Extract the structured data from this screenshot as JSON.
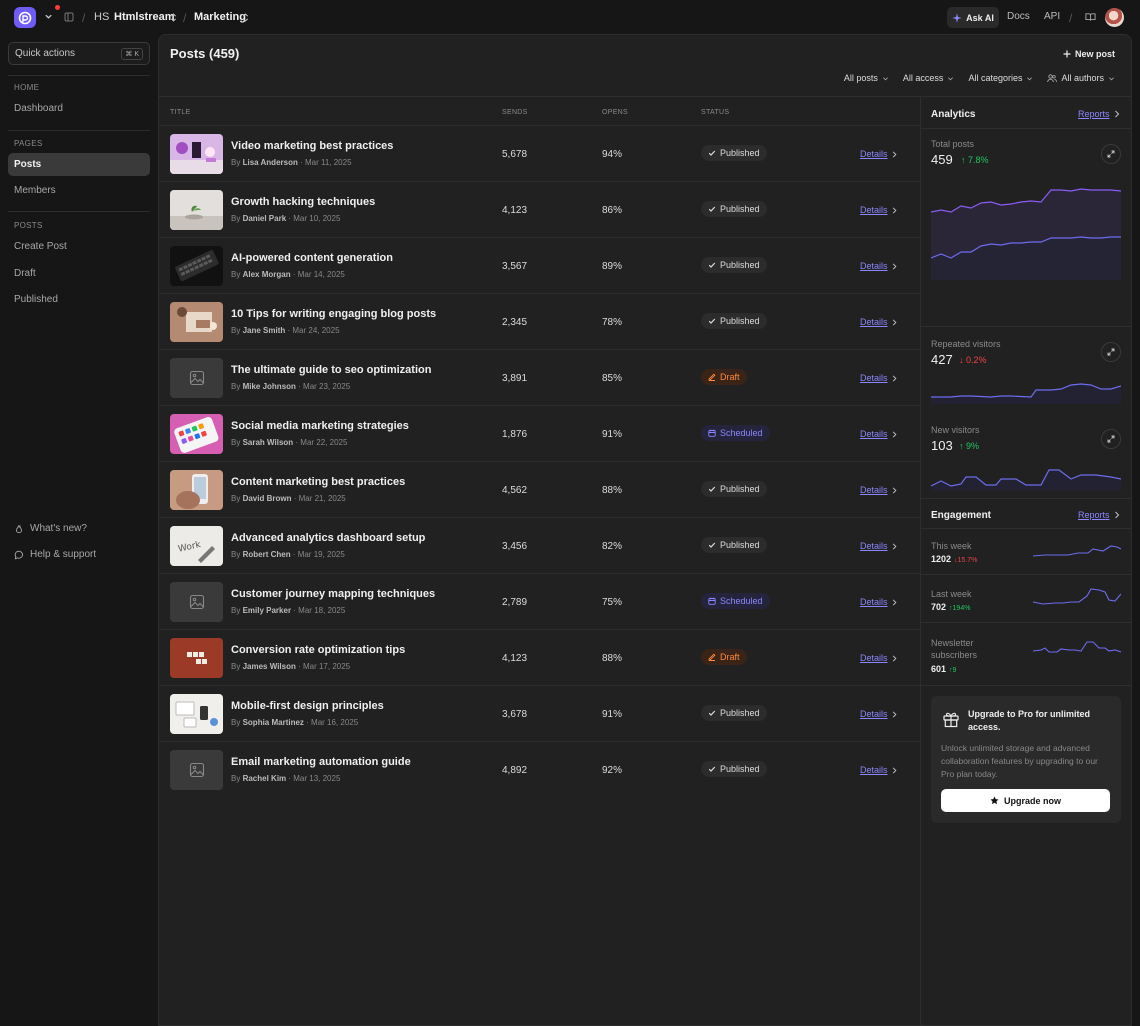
{
  "topbar": {
    "workspace_initials": "HS",
    "org": "Htmlstream",
    "project": "Marketing",
    "ask_ai": "Ask AI",
    "docs": "Docs",
    "api": "API"
  },
  "sidebar": {
    "quick_actions": "Quick actions",
    "shortcut": "⌘ K",
    "sec_home": "HOME",
    "dashboard": "Dashboard",
    "sec_pages": "PAGES",
    "posts": "Posts",
    "members": "Members",
    "sec_posts": "POSTS",
    "create_post": "Create Post",
    "draft": "Draft",
    "published": "Published",
    "whats_new": "What's new?",
    "help": "Help & support"
  },
  "main": {
    "title": "Posts (459)",
    "new_post": "New post",
    "filters": [
      "All posts",
      "All access",
      "All categories",
      "All authors"
    ],
    "headers": {
      "title": "TITLE",
      "sends": "SENDS",
      "opens": "OPENS",
      "status": "STATUS"
    },
    "details_label": "Details",
    "by_label": "By",
    "rows": [
      {
        "title": "Video marketing best practices",
        "author": "Lisa Anderson",
        "date": "Mar 11, 2025",
        "sends": "5,678",
        "opens": "94%",
        "status": "Published"
      },
      {
        "title": "Growth hacking techniques",
        "author": "Daniel Park",
        "date": "Mar 10, 2025",
        "sends": "4,123",
        "opens": "86%",
        "status": "Published"
      },
      {
        "title": "AI-powered content generation",
        "author": "Alex Morgan",
        "date": "Mar 14, 2025",
        "sends": "3,567",
        "opens": "89%",
        "status": "Published"
      },
      {
        "title": "10 Tips for writing engaging blog posts",
        "author": "Jane Smith",
        "date": "Mar 24, 2025",
        "sends": "2,345",
        "opens": "78%",
        "status": "Published"
      },
      {
        "title": "The ultimate guide to seo optimization",
        "author": "Mike Johnson",
        "date": "Mar 23, 2025",
        "sends": "3,891",
        "opens": "85%",
        "status": "Draft"
      },
      {
        "title": "Social media marketing strategies",
        "author": "Sarah Wilson",
        "date": "Mar 22, 2025",
        "sends": "1,876",
        "opens": "91%",
        "status": "Scheduled"
      },
      {
        "title": "Content marketing best practices",
        "author": "David Brown",
        "date": "Mar 21, 2025",
        "sends": "4,562",
        "opens": "88%",
        "status": "Published"
      },
      {
        "title": "Advanced analytics dashboard setup",
        "author": "Robert Chen",
        "date": "Mar 19, 2025",
        "sends": "3,456",
        "opens": "82%",
        "status": "Published"
      },
      {
        "title": "Customer journey mapping techniques",
        "author": "Emily Parker",
        "date": "Mar 18, 2025",
        "sends": "2,789",
        "opens": "75%",
        "status": "Scheduled"
      },
      {
        "title": "Conversion rate optimization tips",
        "author": "James Wilson",
        "date": "Mar 17, 2025",
        "sends": "4,123",
        "opens": "88%",
        "status": "Draft"
      },
      {
        "title": "Mobile-first design principles",
        "author": "Sophia Martinez",
        "date": "Mar 16, 2025",
        "sends": "3,678",
        "opens": "91%",
        "status": "Published"
      },
      {
        "title": "Email marketing automation guide",
        "author": "Rachel Kim",
        "date": "Mar 13, 2025",
        "sends": "4,892",
        "opens": "92%",
        "status": "Published"
      }
    ]
  },
  "analytics": {
    "title": "Analytics",
    "reports": "Reports",
    "total_posts_label": "Total posts",
    "total_posts_value": "459",
    "total_posts_delta": "↑ 7.8%",
    "repeated_label": "Repeated visitors",
    "repeated_value": "427",
    "repeated_delta": "↓ 0.2%",
    "new_label": "New visitors",
    "new_value": "103",
    "new_delta": "↑ 9%"
  },
  "engagement": {
    "title": "Engagement",
    "reports": "Reports",
    "items": [
      {
        "label": "This week",
        "value": "1202",
        "delta": "↓15.7%",
        "trend": "down"
      },
      {
        "label": "Last week",
        "value": "702",
        "delta": "↑194%",
        "trend": "up"
      },
      {
        "label": "Newsletter subscribers",
        "value": "601",
        "delta": "↑9",
        "trend": "up"
      }
    ]
  },
  "upgrade": {
    "title": "Upgrade to Pro for unlimited access.",
    "desc": "Unlock unlimited storage and advanced collaboration features by upgrading to our Pro plan today.",
    "button": "Upgrade now"
  },
  "colors": {
    "accent": "#8c86ff",
    "brand": "#6f5bf5",
    "up": "#22c55e",
    "down": "#ef4444",
    "draft": "#ff8a3d"
  }
}
